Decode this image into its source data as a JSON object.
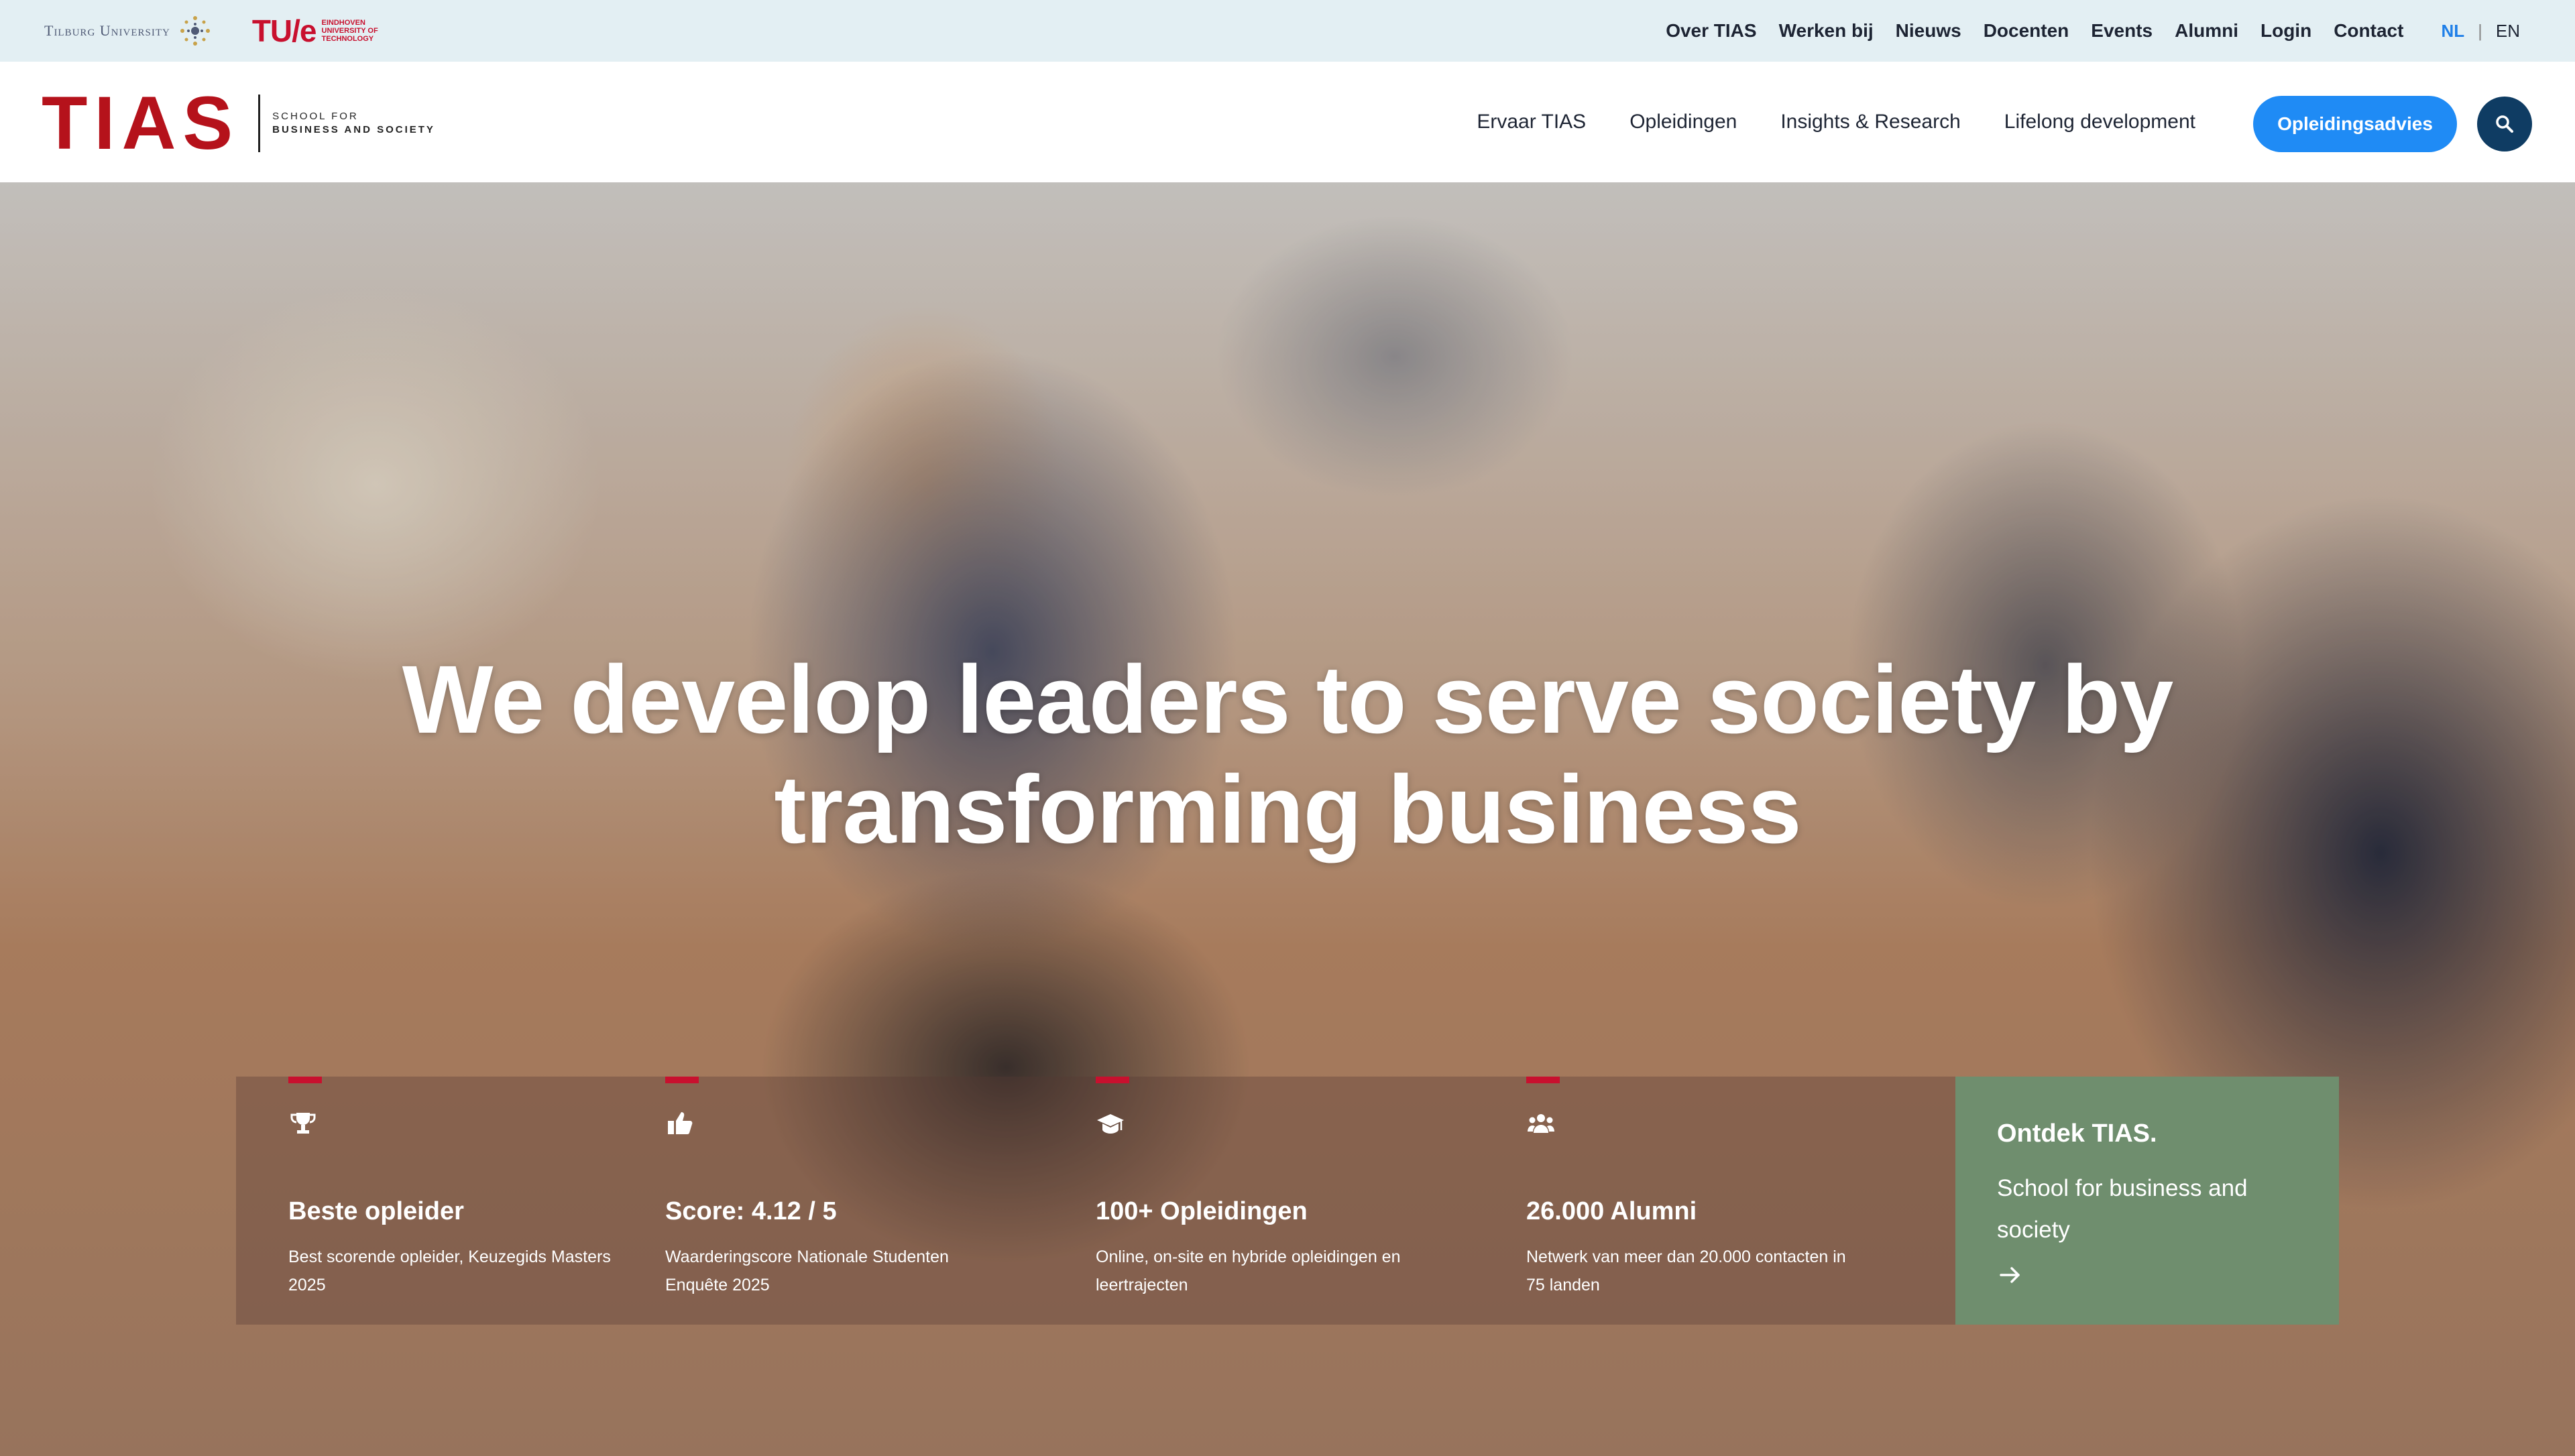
{
  "partners": {
    "tilburg_label": "Tilburg University",
    "tue_mark": "TU/e",
    "tue_text": [
      "Eindhoven",
      "University of",
      "Technology"
    ]
  },
  "utility_nav": [
    "Over TIAS",
    "Werken bij",
    "Nieuws",
    "Docenten",
    "Events",
    "Alumni",
    "Login",
    "Contact"
  ],
  "language": {
    "active": "NL",
    "separator": "|",
    "other": "EN"
  },
  "brand": {
    "mark": "TIAS",
    "tagline_top": "School for",
    "tagline_bottom": "Business and Society"
  },
  "primary_nav": [
    "Ervaar TIAS",
    "Opleidingen",
    "Insights & Research",
    "Lifelong development"
  ],
  "cta_label": "Opleidingsadvies",
  "hero": {
    "headline": "We develop leaders to serve society by transforming business"
  },
  "stats": [
    {
      "icon": "trophy-icon",
      "title": "Beste opleider",
      "description": "Best scorende opleider, Keuzegids Masters 2025"
    },
    {
      "icon": "thumbs-up-icon",
      "title": "Score: 4.12 / 5",
      "description": "Waarderingscore Nationale Studenten Enquête 2025"
    },
    {
      "icon": "graduation-cap-icon",
      "title": "100+ Opleidingen",
      "description": "Online, on-site en hybride opleidingen en leertrajecten"
    },
    {
      "icon": "users-icon",
      "title": "26.000 Alumni",
      "description": "Netwerk van meer dan 20.000 contacten in 75 landen"
    }
  ],
  "ontdek": {
    "title": "Ontdek TIAS.",
    "description": "School for business and society",
    "icon": "arrow-right-icon"
  },
  "colors": {
    "brand_red": "#b5121b",
    "cta_blue": "#1f8bf5",
    "search_navy": "#0f3c63",
    "ontdek_green": "#6f8e6e",
    "utility_bg": "#e3eff3"
  }
}
